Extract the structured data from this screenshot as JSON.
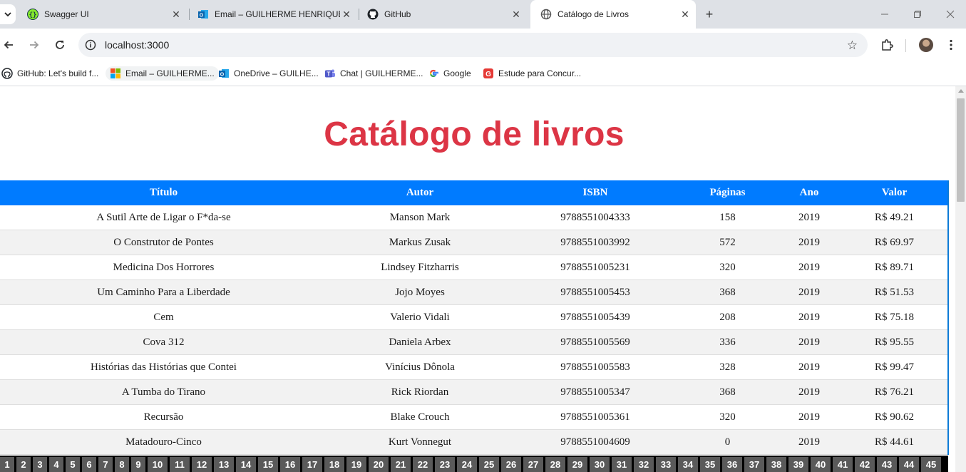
{
  "browser": {
    "tabs": [
      {
        "title": "Swagger UI",
        "icon": "swagger-icon",
        "active": false
      },
      {
        "title": "Email – GUILHERME HENRIQUE",
        "icon": "outlook-icon",
        "active": false
      },
      {
        "title": "GitHub",
        "icon": "github-icon",
        "active": false
      },
      {
        "title": "Catálogo de Livros",
        "icon": "globe-icon",
        "active": true
      }
    ],
    "url": "localhost:3000",
    "bookmarks": [
      {
        "label": "GitHub: Let's build f...",
        "icon": "github-icon"
      },
      {
        "label": "Email – GUILHERME...",
        "icon": "microsoft-icon"
      },
      {
        "label": "OneDrive – GUILHE...",
        "icon": "outlook-icon"
      },
      {
        "label": "Chat | GUILHERME...",
        "icon": "teams-icon"
      },
      {
        "label": "Google",
        "icon": "google-icon"
      },
      {
        "label": "Estude para Concur...",
        "icon": "estude-icon"
      }
    ]
  },
  "page": {
    "title": "Catálogo de livros",
    "columns": [
      "Título",
      "Autor",
      "ISBN",
      "Páginas",
      "Ano",
      "Valor"
    ],
    "rows": [
      [
        "A Sutil Arte de Ligar o F*da-se",
        "Manson Mark",
        "9788551004333",
        "158",
        "2019",
        "R$ 49.21"
      ],
      [
        "O Construtor de Pontes",
        "Markus Zusak",
        "9788551003992",
        "572",
        "2019",
        "R$ 69.97"
      ],
      [
        "Medicina Dos Horrores",
        "Lindsey Fitzharris",
        "9788551005231",
        "320",
        "2019",
        "R$ 89.71"
      ],
      [
        "Um Caminho Para a Liberdade",
        "Jojo Moyes",
        "9788551005453",
        "368",
        "2019",
        "R$ 51.53"
      ],
      [
        "Cem",
        "Valerio Vidali",
        "9788551005439",
        "208",
        "2019",
        "R$ 75.18"
      ],
      [
        "Cova 312",
        "Daniela Arbex",
        "9788551005569",
        "336",
        "2019",
        "R$ 95.55"
      ],
      [
        "Histórias das Histórias que Contei",
        "Vinícius Dônola",
        "9788551005583",
        "328",
        "2019",
        "R$ 99.47"
      ],
      [
        "A Tumba do Tirano",
        "Rick Riordan",
        "9788551005347",
        "368",
        "2019",
        "R$ 76.21"
      ],
      [
        "Recursão",
        "Blake Crouch",
        "9788551005361",
        "320",
        "2019",
        "R$ 90.62"
      ],
      [
        "Matadouro-Cinco",
        "Kurt Vonnegut",
        "9788551004609",
        "0",
        "2019",
        "R$ 44.61"
      ]
    ],
    "pages": [
      "1",
      "2",
      "3",
      "4",
      "5",
      "6",
      "7",
      "8",
      "9",
      "10",
      "11",
      "12",
      "13",
      "14",
      "15",
      "16",
      "17",
      "18",
      "19",
      "20",
      "21",
      "22",
      "23",
      "24",
      "25",
      "26",
      "27",
      "28",
      "29",
      "30",
      "31",
      "32",
      "33",
      "34",
      "35",
      "36",
      "37",
      "38",
      "39",
      "40",
      "41",
      "42",
      "43",
      "44",
      "45"
    ]
  },
  "colors": {
    "title": "#dc3545",
    "header_bg": "#007bff",
    "pager_bg": "#5a5a5a"
  }
}
